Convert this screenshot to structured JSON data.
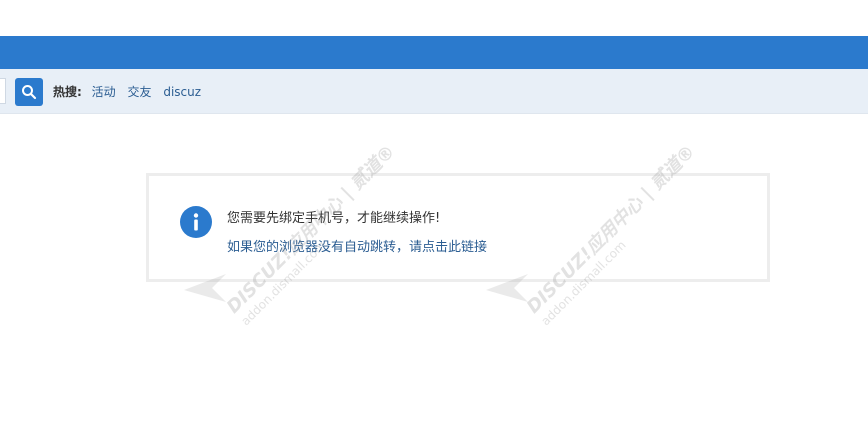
{
  "search": {
    "hot_label": "热搜:",
    "hot_terms": [
      "活动",
      "交友",
      "discuz"
    ]
  },
  "message": {
    "main_text": "您需要先绑定手机号，才能继续操作!",
    "redirect_text": "如果您的浏览器没有自动跳转，请点击此链接"
  },
  "watermarks": [
    {
      "text": "DISCUZ!应用中心 | 贰道®",
      "sub": "addon.dismall.com"
    },
    {
      "text": "DISCUZ!应用中心 | 贰道®",
      "sub": "addon.dismall.com"
    }
  ],
  "colors": {
    "accent": "#2b7acd",
    "link": "#2b5d92",
    "searchbar_bg": "#e8eff7"
  }
}
